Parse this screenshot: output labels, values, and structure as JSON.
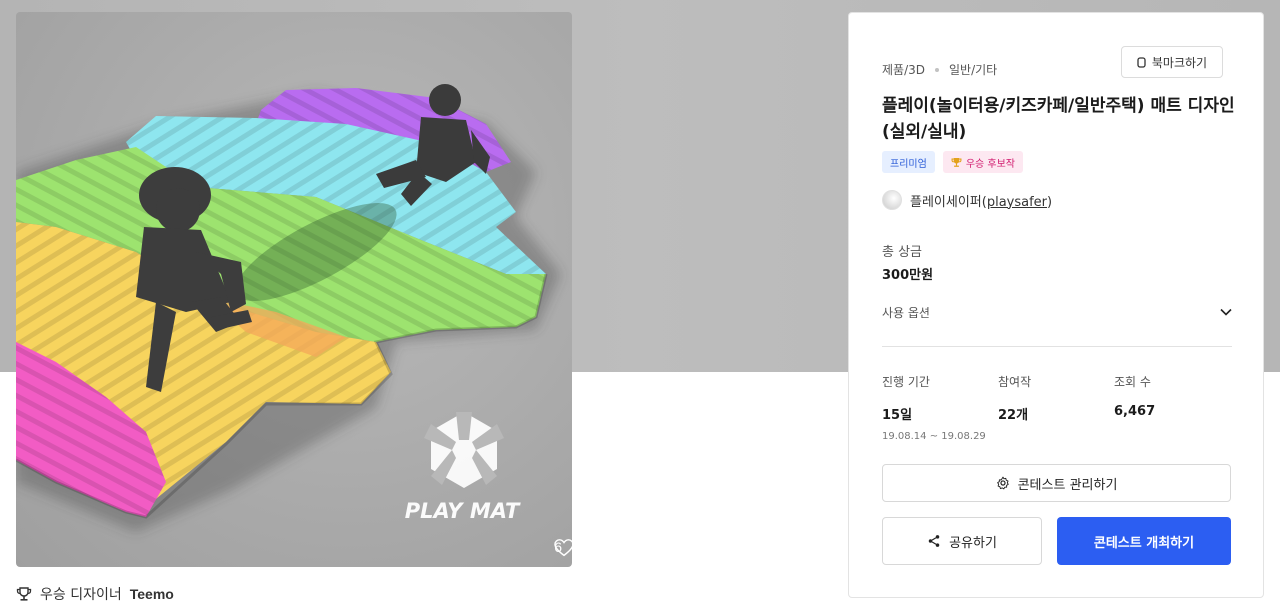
{
  "hero": {
    "watermark_text": "PLAY MAT",
    "like_count": "6",
    "like_icon": "heart-outline-icon"
  },
  "winner": {
    "prefix": "우승 디자이너",
    "name": "Teemo",
    "icon": "trophy-icon"
  },
  "panel": {
    "breadcrumb": [
      "제품/3D",
      "일반/기타"
    ],
    "bookmark_label": "북마크하기",
    "title": "플레이(놀이터용/키즈카페/일반주택) 매트 디자인(실외/실내)",
    "badges": {
      "premium": "프리미엄",
      "award": "우승 후보작"
    },
    "author": {
      "name": "플레이세이퍼",
      "handle": "playsafer"
    },
    "prize": {
      "label": "총 상금",
      "value": "300만원"
    },
    "options_label": "사용 옵션",
    "stats": {
      "duration": {
        "label": "진행 기간",
        "value": "15일",
        "sub": "19.08.14 ~ 19.08.29"
      },
      "entries": {
        "label": "참여작",
        "value": "22개"
      },
      "views": {
        "label": "조회 수",
        "value": "6,467"
      }
    },
    "manage_label": "콘테스트 관리하기",
    "share_label": "공유하기",
    "host_label": "콘테스트 개최하기"
  },
  "colors": {
    "accent": "#2c5ef2",
    "premium_bg": "#e6efff",
    "award_bg": "#fde8f1",
    "mat_pink": "#f25cc4",
    "mat_yellow": "#f7d45e",
    "mat_green": "#9de36f",
    "mat_cyan": "#8ee6ef",
    "mat_purple": "#b96cf0"
  }
}
